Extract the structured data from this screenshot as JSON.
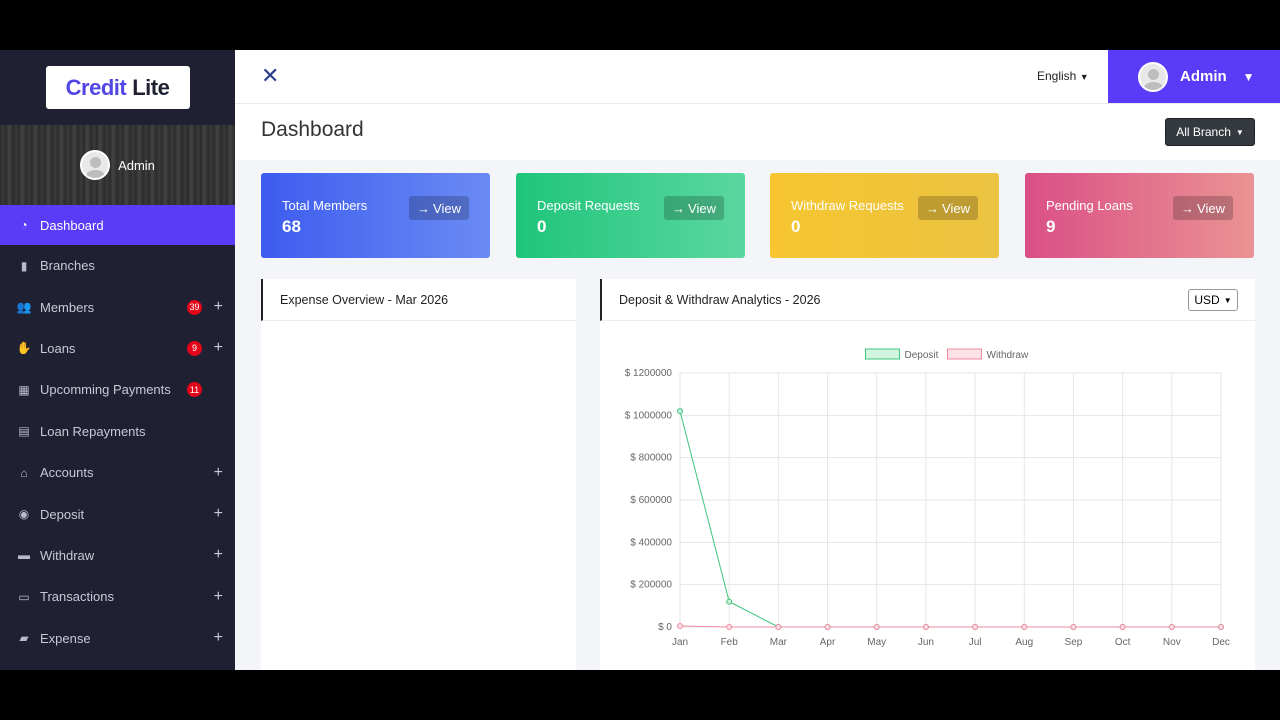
{
  "brand": {
    "part1": "Credit",
    "part2": "Lite"
  },
  "sidebar": {
    "user_name": "Admin",
    "items": [
      {
        "label": "Dashboard",
        "icon": "dashboard-icon",
        "badge": "",
        "plus": ""
      },
      {
        "label": "Branches",
        "icon": "building-icon",
        "badge": "",
        "plus": ""
      },
      {
        "label": "Members",
        "icon": "users-icon",
        "badge": "39",
        "plus": "+"
      },
      {
        "label": "Loans",
        "icon": "hand-money-icon",
        "badge": "9",
        "plus": "+"
      },
      {
        "label": "Upcomming Payments",
        "icon": "calendar-icon",
        "badge": "11",
        "plus": ""
      },
      {
        "label": "Loan Repayments",
        "icon": "receipt-icon",
        "badge": "",
        "plus": ""
      },
      {
        "label": "Accounts",
        "icon": "bank-icon",
        "badge": "",
        "plus": "+"
      },
      {
        "label": "Deposit",
        "icon": "coins-icon",
        "badge": "",
        "plus": "+"
      },
      {
        "label": "Withdraw",
        "icon": "wallet-icon",
        "badge": "",
        "plus": "+"
      },
      {
        "label": "Transactions",
        "icon": "card-icon",
        "badge": "",
        "plus": "+"
      },
      {
        "label": "Expense",
        "icon": "money-icon",
        "badge": "",
        "plus": "+"
      }
    ]
  },
  "topbar": {
    "language": "English",
    "admin_name": "Admin"
  },
  "header": {
    "title": "Dashboard",
    "branch_label": "All Branch"
  },
  "stats": [
    {
      "label": "Total Members",
      "value": "68",
      "view": "View"
    },
    {
      "label": "Deposit Requests",
      "value": "0",
      "view": "View"
    },
    {
      "label": "Withdraw Requests",
      "value": "0",
      "view": "View"
    },
    {
      "label": "Pending Loans",
      "value": "9",
      "view": "View"
    }
  ],
  "expense_panel": {
    "title": "Expense Overview - Mar 2026"
  },
  "analytics_panel": {
    "title": "Deposit & Withdraw Analytics - 2026",
    "currency": "USD"
  },
  "colors": {
    "accent": "#5a3cf8",
    "deposit": "#3cc47c",
    "withdraw": "#f08aa0"
  },
  "chart_data": {
    "type": "line",
    "x": [
      "Jan",
      "Feb",
      "Mar",
      "Apr",
      "May",
      "Jun",
      "Jul",
      "Aug",
      "Sep",
      "Oct",
      "Nov",
      "Dec"
    ],
    "series": [
      {
        "name": "Deposit",
        "values": [
          1020000,
          120000,
          0,
          0,
          0,
          0,
          0,
          0,
          0,
          0,
          0,
          0
        ]
      },
      {
        "name": "Withdraw",
        "values": [
          5000,
          0,
          0,
          0,
          0,
          0,
          0,
          0,
          0,
          0,
          0,
          0
        ]
      }
    ],
    "yticks": [
      "$ 0",
      "$ 200000",
      "$ 400000",
      "$ 600000",
      "$ 800000",
      "$ 1000000",
      "$ 1200000"
    ],
    "ylim": [
      0,
      1200000
    ],
    "grid": true,
    "legend": "top-center"
  }
}
